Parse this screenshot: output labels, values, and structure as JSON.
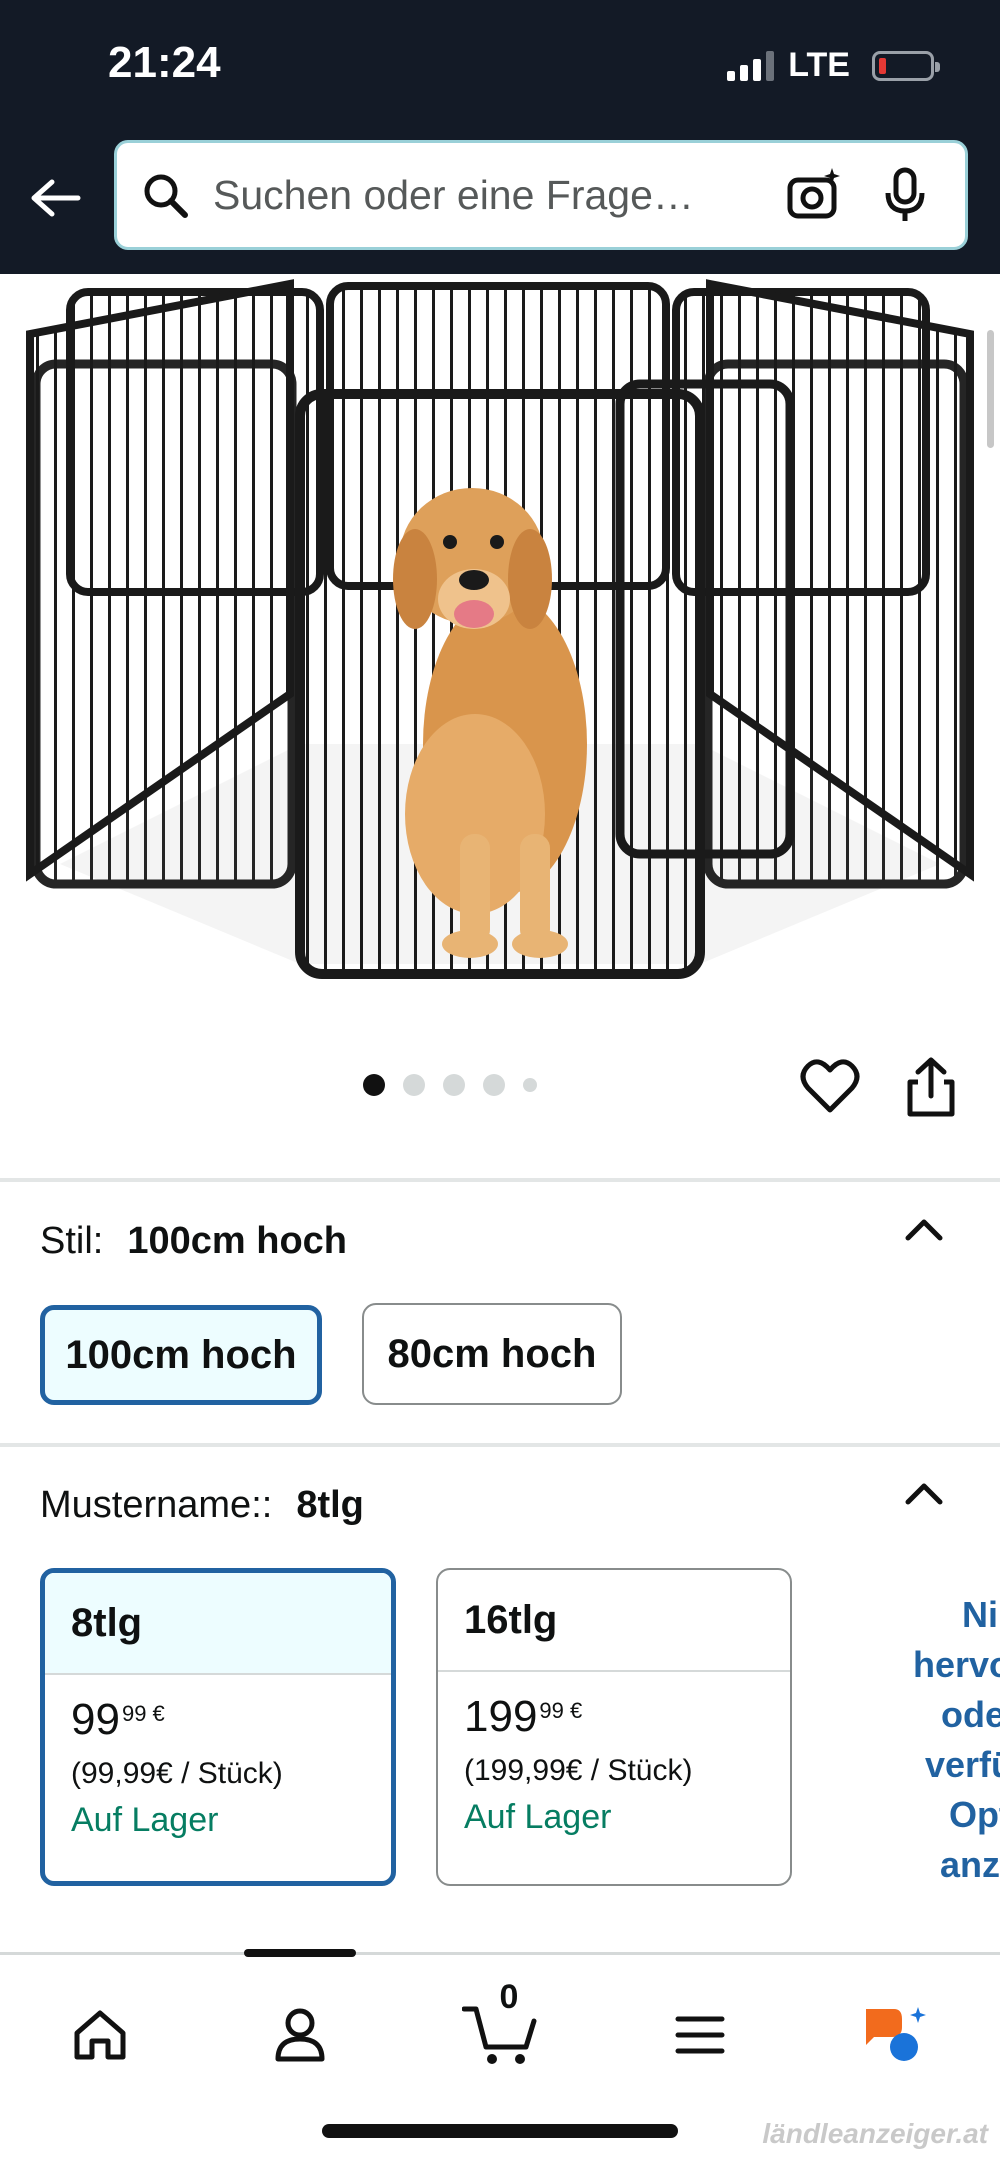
{
  "status_bar": {
    "time": "21:24",
    "network": "LTE"
  },
  "search": {
    "placeholder": "Suchen oder eine Frage…"
  },
  "gallery": {
    "image_count": 5,
    "active_index": 0
  },
  "style_section": {
    "label": "Stil:",
    "selected": "100cm hoch",
    "options": [
      "100cm hoch",
      "80cm hoch"
    ]
  },
  "pattern_section": {
    "label": "Mustername::",
    "selected": "8tlg",
    "options": [
      {
        "name": "8tlg",
        "price_whole": "99",
        "price_fraction": "99 €",
        "unit_price": "(99,99€ / Stück)",
        "stock": "Auf Lager"
      },
      {
        "name": "16tlg",
        "price_whole": "199",
        "price_fraction": "99 €",
        "unit_price": "(199,99€ / Stück)",
        "stock": "Auf Lager"
      }
    ],
    "side_note_lines": [
      "Ni",
      "hervorg",
      "oder",
      "verfüg",
      "Opt",
      "anze"
    ]
  },
  "bottom_nav": {
    "cart_count": "0"
  },
  "watermark": "ländleanzeiger.at",
  "colors": {
    "header_bg": "#131a26",
    "selected_border": "#2162a1",
    "stock_green": "#067d62"
  }
}
